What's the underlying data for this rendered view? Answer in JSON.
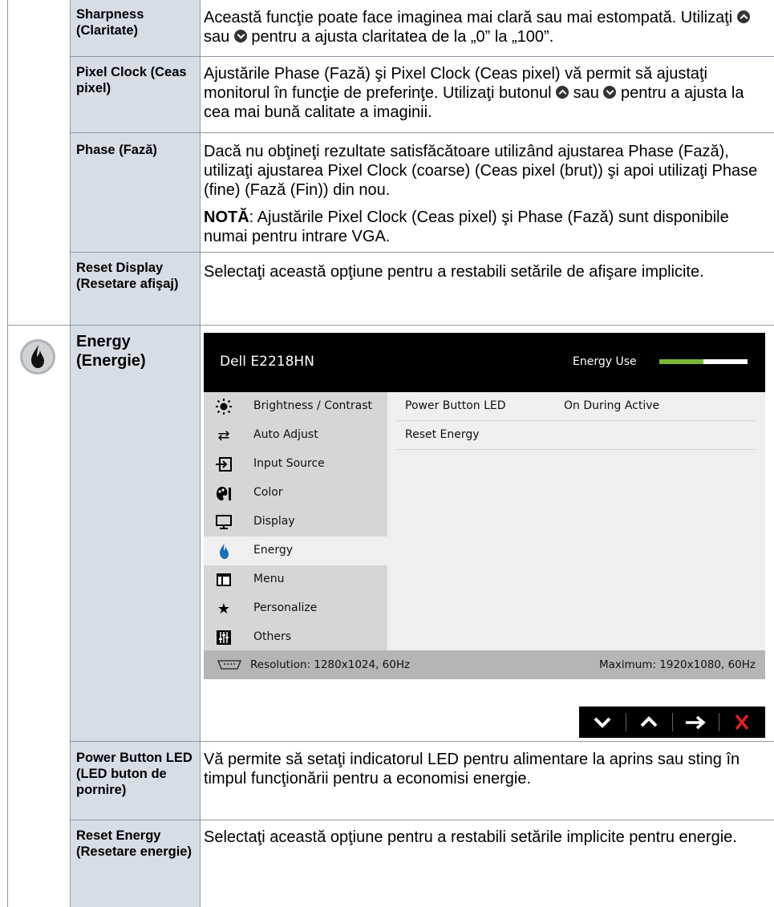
{
  "rows": [
    {
      "label": "Sharpness (Claritate)",
      "desc_parts": [
        "Această funcţie poate face imaginea mai clară sau mai estompată. Utilizaţi ",
        " sau ",
        " pentru a ajusta claritatea de la „0” la „100”."
      ]
    },
    {
      "label": "Pixel Clock (Ceas pixel)",
      "desc_parts": [
        "Ajustările Phase (Fază) şi Pixel Clock (Ceas pixel) vă permit să ajustaţi monitorul în funcţie de preferinţe. Utilizaţi butonul ",
        " sau ",
        " pentru a ajusta la cea mai bună calitate a imaginii."
      ]
    },
    {
      "label": "Phase (Fază)",
      "desc": "Dacă nu obţineţi rezultate satisfăcătoare utilizând ajustarea Phase (Fază), utilizaţi ajustarea Pixel Clock (coarse) (Ceas pixel (brut)) şi apoi utilizaţi Phase (fine) (Fază (Fin)) din nou.",
      "note_label": "NOTĂ",
      "note_text": ": Ajustările Pixel Clock (Ceas pixel) şi Phase (Fază) sunt disponibile numai pentru intrare VGA."
    },
    {
      "label": "Reset Display (Resetare afişaj)",
      "desc": "Selectaţi această opţiune pentru a restabili setările de afişare implicite."
    },
    {
      "label": "Energy (Energie)"
    },
    {
      "label": "Power Button LED (LED buton de pornire)",
      "desc": "Vă permite să setaţi indicatorul LED pentru alimentare la aprins sau sting în timpul funcţionării pentru a economisi energie."
    },
    {
      "label": "Reset Energy (Resetare energie)",
      "desc": "Selectaţi această opţiune pentru a restabili setările implicite pentru energie."
    }
  ],
  "osd": {
    "model": "Dell E2218HN",
    "energy_use_label": "Energy Use",
    "energy_use_level": 0.5,
    "menu": [
      {
        "label": "Brightness / Contrast",
        "icon": "sun-icon"
      },
      {
        "label": "Auto Adjust",
        "icon": "auto-adjust-icon"
      },
      {
        "label": "Input Source",
        "icon": "input-source-icon"
      },
      {
        "label": "Color",
        "icon": "palette-icon"
      },
      {
        "label": "Display",
        "icon": "monitor-icon"
      },
      {
        "label": "Energy",
        "icon": "flame-icon",
        "active": true
      },
      {
        "label": "Menu",
        "icon": "menu-window-icon"
      },
      {
        "label": "Personalize",
        "icon": "star-icon"
      },
      {
        "label": "Others",
        "icon": "sliders-icon"
      }
    ],
    "settings": [
      {
        "key": "Power Button LED",
        "value": "On During Active"
      },
      {
        "key": "Reset Energy",
        "value": ""
      }
    ],
    "resolution": "Resolution: 1280x1024, 60Hz",
    "maximum": "Maximum: 1920x1080, 60Hz"
  },
  "nav_buttons": [
    "chevron-down-icon",
    "chevron-up-icon",
    "arrow-right-icon",
    "close-icon"
  ],
  "colors": {
    "label_column": "#d6dde5",
    "energy_bar": "#7ab833",
    "flame": "#1a6fb5",
    "close": "#e02020"
  }
}
